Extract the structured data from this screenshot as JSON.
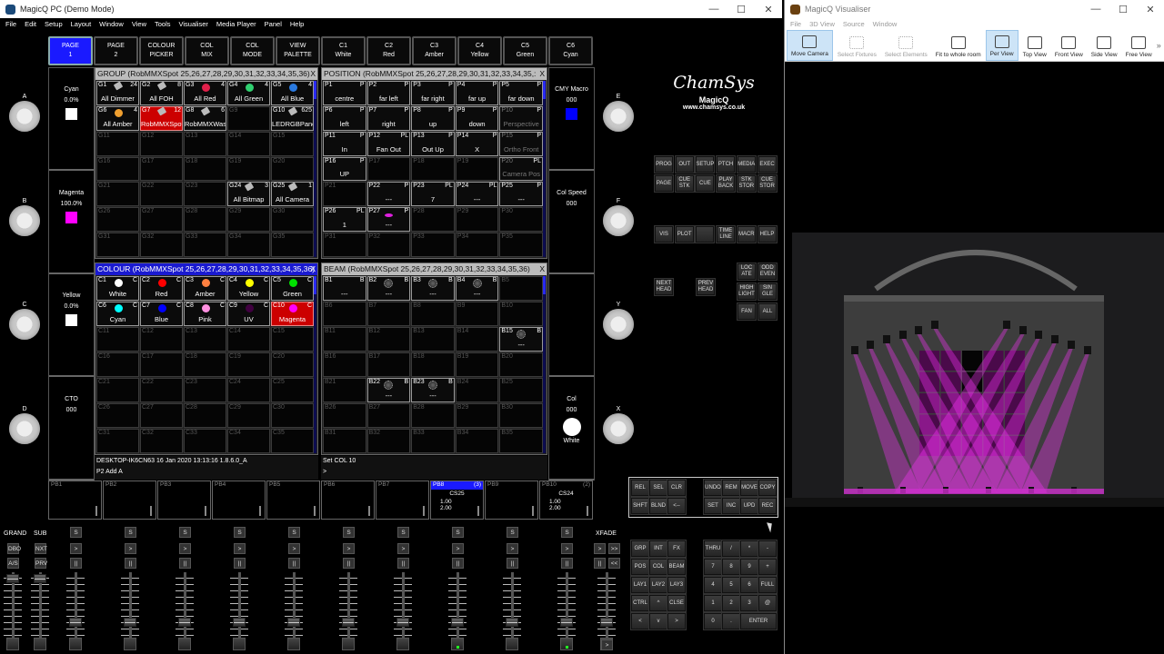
{
  "main_window": {
    "title": "MagicQ PC (Demo Mode)",
    "controls": [
      "—",
      "☐",
      "✕"
    ],
    "menu": [
      "File",
      "Edit",
      "Setup",
      "Layout",
      "Window",
      "View",
      "Tools",
      "Visualiser",
      "Media Player",
      "Panel",
      "Help"
    ]
  },
  "top_buttons": [
    {
      "l1": "PAGE",
      "l2": "1",
      "active": true
    },
    {
      "l1": "PAGE",
      "l2": "2"
    },
    {
      "l1": "COLOUR",
      "l2": "PICKER"
    },
    {
      "l1": "COL",
      "l2": "MIX"
    },
    {
      "l1": "COL",
      "l2": "MODE"
    },
    {
      "l1": "VIEW",
      "l2": "PALETTE"
    },
    {
      "l1": "C1",
      "l2": "White"
    },
    {
      "l1": "C2",
      "l2": "Red"
    },
    {
      "l1": "C3",
      "l2": "Amber"
    },
    {
      "l1": "C4",
      "l2": "Yellow"
    },
    {
      "l1": "C5",
      "l2": "Green"
    },
    {
      "l1": "C6",
      "l2": "Cyan"
    }
  ],
  "group": {
    "title": "GROUP (RobMMXSpot 25,26,27,28,29,30,31,32,33,34,35,36)",
    "close": "X",
    "prefix": "G",
    "cells": {
      "1": {
        "label": "All Dimmer",
        "tag": "24",
        "icon": "fix"
      },
      "2": {
        "label": "All FOH",
        "tag": "8",
        "icon": "fix"
      },
      "3": {
        "label": "All Red",
        "tag": "4",
        "dot": "#e0204a"
      },
      "4": {
        "label": "All Green",
        "tag": "4",
        "dot": "#30d070"
      },
      "5": {
        "label": "All Blue",
        "tag": "4",
        "dot": "#2a7ae0"
      },
      "6": {
        "label": "All Amber",
        "tag": "4",
        "dot": "#f0a030"
      },
      "7": {
        "label": "RobMMXSpot",
        "tag": "12",
        "icon": "fix",
        "active": true
      },
      "8": {
        "label": "RobMMXWashB",
        "tag": "6",
        "icon": "fix"
      },
      "10": {
        "label": "LEDRGBPanel",
        "tag": "625",
        "icon": "fix"
      },
      "24": {
        "label": "All Bitmap",
        "tag": "3",
        "icon": "fix"
      },
      "25": {
        "label": "All Camera",
        "tag": "1",
        "icon": "fix"
      }
    }
  },
  "position": {
    "title": "POSITION (RobMMXSpot 25,26,27,28,29,30,31,32,33,34,35,:",
    "close": "X",
    "prefix": "P",
    "cells": {
      "1": {
        "label": "centre",
        "tag": "P"
      },
      "2": {
        "label": "far left",
        "tag": "P"
      },
      "3": {
        "label": "far right",
        "tag": "P"
      },
      "4": {
        "label": "far up",
        "tag": "P"
      },
      "5": {
        "label": "far down",
        "tag": "P"
      },
      "6": {
        "label": "left",
        "tag": "P"
      },
      "7": {
        "label": "right",
        "tag": "P"
      },
      "8": {
        "label": "up",
        "tag": "P"
      },
      "9": {
        "label": "down",
        "tag": "P"
      },
      "10": {
        "label": "Perspective",
        "tag": "P",
        "dim": true
      },
      "11": {
        "label": "In",
        "tag": "P"
      },
      "12": {
        "label": "Fan Out",
        "tag": "PL"
      },
      "13": {
        "label": "Out Up",
        "tag": "P"
      },
      "14": {
        "label": "X",
        "tag": "P"
      },
      "15": {
        "label": "Ortho Front",
        "tag": "P",
        "dim": true
      },
      "16": {
        "label": "UP",
        "tag": "P"
      },
      "20": {
        "label": "Camera Pos",
        "tag": "PL",
        "dim": true
      },
      "22": {
        "label": "---",
        "tag": "P"
      },
      "23": {
        "label": "7",
        "tag": "PL"
      },
      "24": {
        "label": "---",
        "tag": "PL"
      },
      "25": {
        "label": "---",
        "tag": "P"
      },
      "26": {
        "label": "1",
        "tag": "PL"
      },
      "27": {
        "label": "---",
        "tag": "P",
        "dot": "#e020e0"
      }
    }
  },
  "colour": {
    "title": "COLOUR (RobMMXSpot 25,26,27,28,29,30,31,32,33,34,35,36)",
    "close": "X",
    "prefix": "C",
    "selected": true,
    "cells": {
      "1": {
        "label": "White",
        "tag": "C",
        "dot": "#ffffff"
      },
      "2": {
        "label": "Red",
        "tag": "C",
        "dot": "#ff0000"
      },
      "3": {
        "label": "Amber",
        "tag": "C",
        "dot": "#ff8040"
      },
      "4": {
        "label": "Yellow",
        "tag": "C",
        "dot": "#ffff00"
      },
      "5": {
        "label": "Green",
        "tag": "C",
        "dot": "#00e000"
      },
      "6": {
        "label": "Cyan",
        "tag": "C",
        "dot": "#00ffff"
      },
      "7": {
        "label": "Blue",
        "tag": "C",
        "dot": "#0000ff"
      },
      "8": {
        "label": "Pink",
        "tag": "C",
        "dot": "#ff90e0"
      },
      "9": {
        "label": "UV",
        "tag": "C",
        "dot": "#400040"
      },
      "10": {
        "label": "Magenta",
        "tag": "C",
        "dot": "#ff00ff",
        "active": true
      }
    }
  },
  "beam": {
    "title": "BEAM (RobMMXSpot 25,26,27,28,29,30,31,32,33,34,35,36)",
    "close": "X",
    "prefix": "B",
    "cells": {
      "1": {
        "label": "---",
        "tag": "B"
      },
      "2": {
        "label": "---",
        "tag": "B",
        "icon": "gobo"
      },
      "3": {
        "label": "---",
        "tag": "B",
        "icon": "gobo"
      },
      "4": {
        "label": "---",
        "tag": "B",
        "icon": "gobo"
      },
      "15": {
        "label": "---",
        "tag": "B",
        "icon": "gobo"
      },
      "22": {
        "label": "---",
        "tag": "B",
        "icon": "gobo"
      },
      "23": {
        "label": "---",
        "tag": "B",
        "icon": "gobo"
      }
    }
  },
  "status": {
    "info": "DESKTOP-IK6CN63 16 Jan 2020 13:13:16 1.8.6.0_A",
    "last_cmd": "P2  Add A",
    "message": "Set COL 10",
    "prompt": ">"
  },
  "encoders_left": [
    {
      "knob": "A",
      "name": "Cyan",
      "value": "0.0%",
      "swatch": "#ffffff"
    },
    {
      "knob": "B",
      "name": "Magenta",
      "value": "100.0%",
      "swatch": "#ff00ff"
    },
    {
      "knob": "C",
      "name": "Yellow",
      "value": "0.0%",
      "swatch": "#ffffff"
    },
    {
      "knob": "D",
      "name": "CTO",
      "value": "000"
    }
  ],
  "encoders_right": [
    {
      "knob": "E",
      "name": "CMY Macro",
      "value": "000",
      "swatch": "#0000ff"
    },
    {
      "knob": "F",
      "name": "Col Speed",
      "value": "000"
    },
    {
      "knob": "Y",
      "name": "",
      "value": ""
    },
    {
      "knob": "X",
      "name": "Col",
      "value": "000",
      "circle": "#ffffff",
      "sub": "White"
    }
  ],
  "playbacks": [
    {
      "id": "PB1"
    },
    {
      "id": "PB2"
    },
    {
      "id": "PB3"
    },
    {
      "id": "PB4"
    },
    {
      "id": "PB5"
    },
    {
      "id": "PB6"
    },
    {
      "id": "PB7"
    },
    {
      "id": "PB8",
      "count": "(3)",
      "cue": "CS25",
      "v1": "1.00",
      "v2": "2.00",
      "active": true
    },
    {
      "id": "PB9"
    },
    {
      "id": "PB10",
      "count": "(2)",
      "cue": "CS24",
      "v1": "1.00",
      "v2": "2.00"
    }
  ],
  "faders": {
    "grand": "GRAND",
    "sub": "SUB",
    "dbo": "DBO",
    "nxt": "NXT",
    "as": "A/S",
    "prv": "PRV",
    "s": "S",
    "go": ">",
    "pause": "||",
    "xfade": "XFADE",
    "xf_keys": [
      ">",
      ">>",
      "||",
      "<<"
    ],
    "xf_go": ">"
  },
  "logo": {
    "brand": "ChamSys",
    "product": "MagicQ",
    "url": "www.chamsys.co.uk"
  },
  "keys_top": [
    [
      "PROG",
      "OUT",
      "SETUP",
      "PTCH",
      "MEDIA",
      "EXEC"
    ],
    [
      "PAGE",
      "CUE STK",
      "CUE",
      "PLAY BACK",
      "STK STOR",
      "CUE STOR"
    ],
    [
      "VIS",
      "PLOT",
      "",
      "TIME LINE",
      "MACR",
      "HELP"
    ]
  ],
  "keys_head": {
    "next": "NEXT HEAD",
    "prev": "PREV HEAD",
    "grid": [
      [
        "LOC ATE",
        "ODD EVEN"
      ],
      [
        "HIGH LIGHT",
        "SIN GLE"
      ],
      [
        "FAN",
        "ALL"
      ]
    ]
  },
  "keys_prog": [
    [
      "REL",
      "SEL",
      "CLR"
    ],
    [
      "SHFT",
      "BLND",
      "<--"
    ]
  ],
  "keys_edit": [
    [
      "UNDO",
      "REM",
      "MOVE",
      "COPY"
    ],
    [
      "SET",
      "INC",
      "UPD",
      "REC"
    ]
  ],
  "keys_sel": [
    [
      "GRP",
      "INT",
      "FX"
    ],
    [
      "POS",
      "COL",
      "BEAM"
    ],
    [
      "LAY1",
      "LAY2",
      "LAY3"
    ],
    [
      "CTRL",
      "^",
      "CLSE"
    ],
    [
      "<",
      "v",
      ">"
    ]
  ],
  "keypad": [
    [
      "THRU",
      "/",
      "*",
      "-"
    ],
    [
      "7",
      "8",
      "9",
      "+"
    ],
    [
      "4",
      "5",
      "6",
      "FULL"
    ],
    [
      "1",
      "2",
      "3",
      "@"
    ],
    [
      "0",
      ".",
      "ENTER"
    ]
  ],
  "visualiser": {
    "title": "MagicQ Visualiser",
    "controls": [
      "—",
      "☐",
      "✕"
    ],
    "menu": [
      "File",
      "3D View",
      "Source",
      "Window"
    ],
    "tools": [
      {
        "label": "Move Camera",
        "active": true
      },
      {
        "label": "Select Fixtures",
        "dim": true
      },
      {
        "label": "Select Elements",
        "dim": true
      },
      {
        "label": "Fit to whole room"
      },
      {
        "label": "Per View",
        "active": true
      },
      {
        "label": "Top View"
      },
      {
        "label": "Front View"
      },
      {
        "label": "Side View"
      },
      {
        "label": "Free View"
      }
    ],
    "more": "»"
  },
  "colors": {
    "accent": "#1a1aff",
    "active": "#cc0000",
    "beam": "#ff33ff"
  }
}
